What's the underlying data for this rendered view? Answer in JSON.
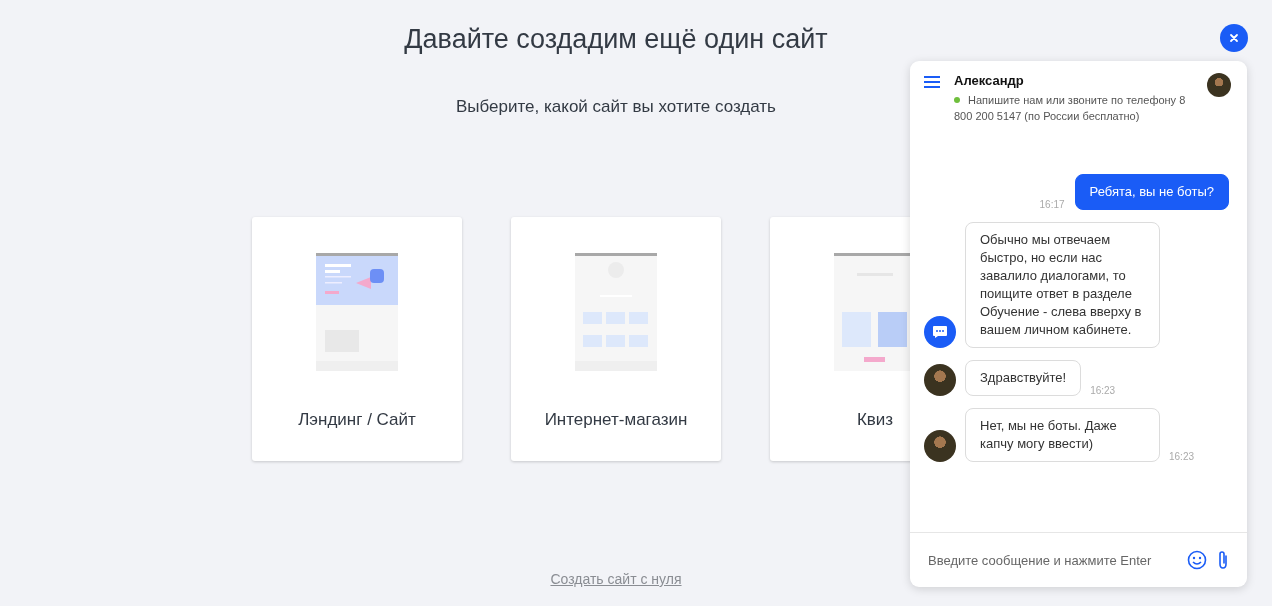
{
  "page": {
    "title": "Давайте создадим ещё один сайт",
    "subtitle": "Выберите, какой сайт вы хотите создать",
    "link": "Создать сайт с нуля"
  },
  "cards": [
    {
      "kind": "landing",
      "label": "Лэндинг / Сайт"
    },
    {
      "kind": "shop",
      "label": "Интернет-магазин"
    },
    {
      "kind": "quiz",
      "label": "Квиз"
    }
  ],
  "chat": {
    "operator": "Александр",
    "online": true,
    "status": "Напишите нам или звоните по телефону 8 800 200 5147 (по России бесплатно)",
    "messages": [
      {
        "kind": "user",
        "text": "Ребята, вы не боты?",
        "time": "16:17"
      },
      {
        "kind": "bot",
        "text": "Обычно мы отвечаем быстро, но если нас завалило диалогами, то поищите ответ в разделе Обучение - слева вверху в вашем личном кабинете."
      },
      {
        "kind": "operator",
        "text": "Здравствуйте!",
        "time": "16:23"
      },
      {
        "kind": "operator",
        "text": "Нет, мы не боты. Даже капчу могу ввести)",
        "time": "16:23"
      }
    ],
    "input": {
      "placeholder": "Введите сообщение и нажмите Enter"
    }
  }
}
